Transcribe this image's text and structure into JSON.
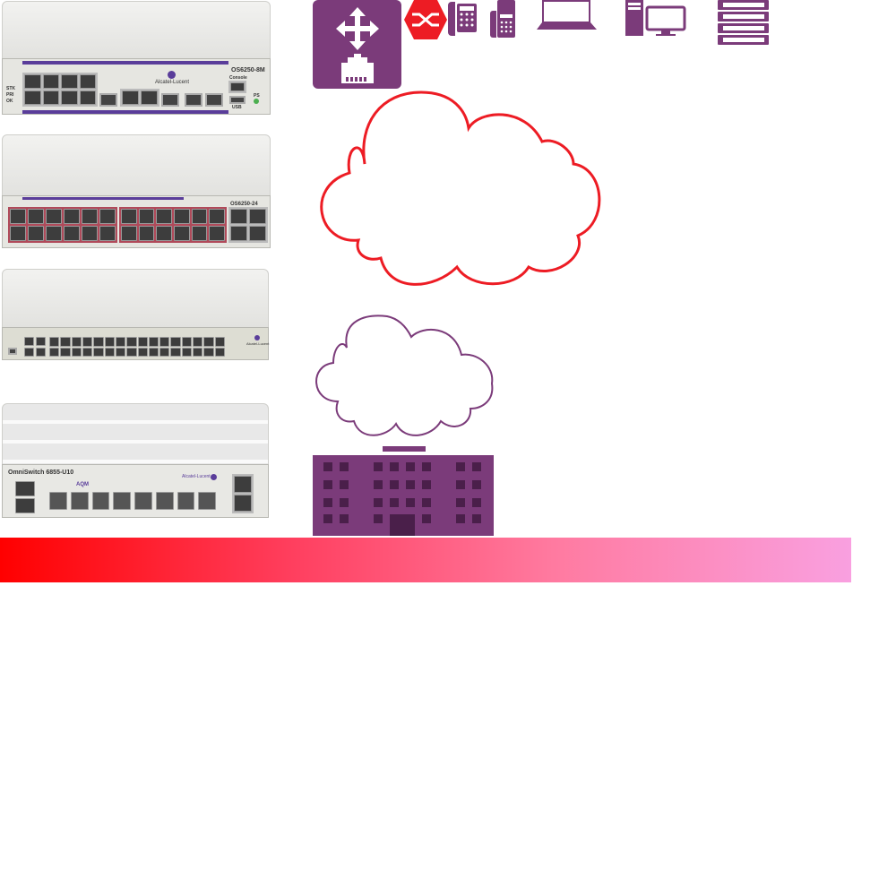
{
  "switches": [
    {
      "model": "OS6250-8M",
      "brand": "Alcatel-Lucent",
      "console": "Console",
      "usb": "USB",
      "ps": "PS",
      "leds": [
        "STK",
        "PRI",
        "OK"
      ]
    },
    {
      "model": "OS6250-24"
    },
    {
      "model": "",
      "brand": "Alcatel-Lucent"
    },
    {
      "model": "OmniSwitch 6855-U10",
      "brand": "Alcatel-Lucent",
      "badge": "AQM"
    }
  ],
  "colors": {
    "purple": "#7b3b7a",
    "red": "#ed1c24",
    "gradient_start": "#ff0000",
    "gradient_end": "#f9a0e0"
  },
  "icons": [
    "router-switch-icon",
    "firewall-icon",
    "desk-phone-icon",
    "ip-phone-icon",
    "laptop-icon",
    "desktop-pc-icon",
    "server-rack-icon",
    "cloud-internet-icon",
    "cloud-private-icon",
    "building-icon"
  ]
}
